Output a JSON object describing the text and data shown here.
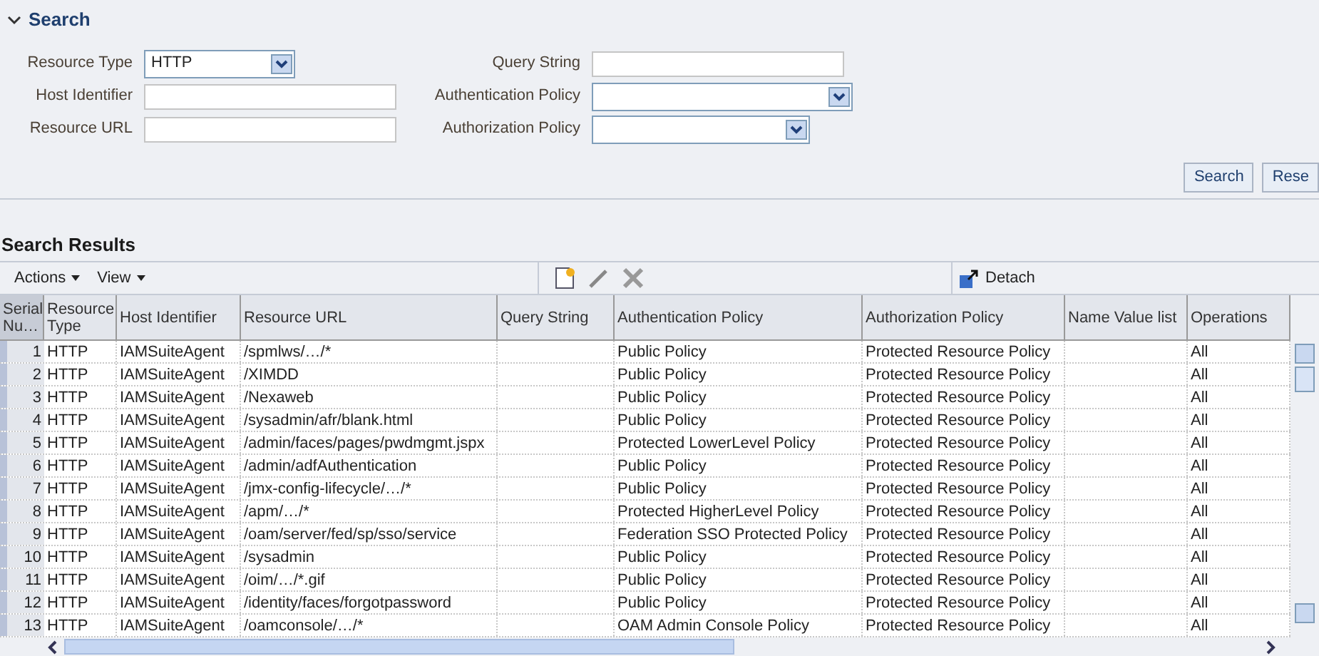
{
  "search": {
    "title": "Search",
    "expanded": true,
    "fields": [
      {
        "label": "Resource Type",
        "kind": "select",
        "value": "HTTP"
      },
      {
        "label": "Host Identifier",
        "kind": "text"
      },
      {
        "label": "Resource URL",
        "kind": "text"
      }
    ],
    "fields_right": [
      {
        "label": "Query String",
        "kind": "text"
      },
      {
        "label": "Authentication Policy",
        "kind": "select"
      },
      {
        "label": "Authorization Policy",
        "kind": "select"
      }
    ],
    "buttons": [
      "Search",
      "Rese"
    ]
  },
  "results": {
    "title": "Search Results",
    "menus": [
      "Actions",
      "View"
    ],
    "detach": "Detach",
    "columns": [
      "Serial Nu…",
      "Resource Type",
      "Host Identifier",
      "Resource URL",
      "Query String",
      "Authentication Policy",
      "Authorization Policy",
      "Name Value list",
      "Operations"
    ],
    "rows": [
      [
        "1",
        "HTTP",
        "IAMSuiteAgent",
        "/spmlws/…/*",
        "",
        "Public Policy",
        "Protected Resource Policy",
        "",
        "All"
      ],
      [
        "2",
        "HTTP",
        "IAMSuiteAgent",
        "/XIMDD",
        "",
        "Public Policy",
        "Protected Resource Policy",
        "",
        "All"
      ],
      [
        "3",
        "HTTP",
        "IAMSuiteAgent",
        "/Nexaweb",
        "",
        "Public Policy",
        "Protected Resource Policy",
        "",
        "All"
      ],
      [
        "4",
        "HTTP",
        "IAMSuiteAgent",
        "/sysadmin/afr/blank.html",
        "",
        "Public Policy",
        "Protected Resource Policy",
        "",
        "All"
      ],
      [
        "5",
        "HTTP",
        "IAMSuiteAgent",
        "/admin/faces/pages/pwdmgmt.jspx",
        "",
        "Protected LowerLevel Policy",
        "Protected Resource Policy",
        "",
        "All"
      ],
      [
        "6",
        "HTTP",
        "IAMSuiteAgent",
        "/admin/adfAuthentication",
        "",
        "Public Policy",
        "Protected Resource Policy",
        "",
        "All"
      ],
      [
        "7",
        "HTTP",
        "IAMSuiteAgent",
        "/jmx-config-lifecycle/…/*",
        "",
        "Public Policy",
        "Protected Resource Policy",
        "",
        "All"
      ],
      [
        "8",
        "HTTP",
        "IAMSuiteAgent",
        "/apm/…/*",
        "",
        "Protected HigherLevel Policy",
        "Protected Resource Policy",
        "",
        "All"
      ],
      [
        "9",
        "HTTP",
        "IAMSuiteAgent",
        "/oam/server/fed/sp/sso/service",
        "",
        "Federation SSO Protected Policy",
        "Protected Resource Policy",
        "",
        "All"
      ],
      [
        "10",
        "HTTP",
        "IAMSuiteAgent",
        "/sysadmin",
        "",
        "Public Policy",
        "Protected Resource Policy",
        "",
        "All"
      ],
      [
        "11",
        "HTTP",
        "IAMSuiteAgent",
        "/oim/…/*.gif",
        "",
        "Public Policy",
        "Protected Resource Policy",
        "",
        "All"
      ],
      [
        "12",
        "HTTP",
        "IAMSuiteAgent",
        "/identity/faces/forgotpassword",
        "",
        "Public Policy",
        "Protected Resource Policy",
        "",
        "All"
      ],
      [
        "13",
        "HTTP",
        "IAMSuiteAgent",
        "/oamconsole/…/*",
        "",
        "OAM Admin Console Policy",
        "Protected Resource Policy",
        "",
        "All"
      ]
    ]
  }
}
